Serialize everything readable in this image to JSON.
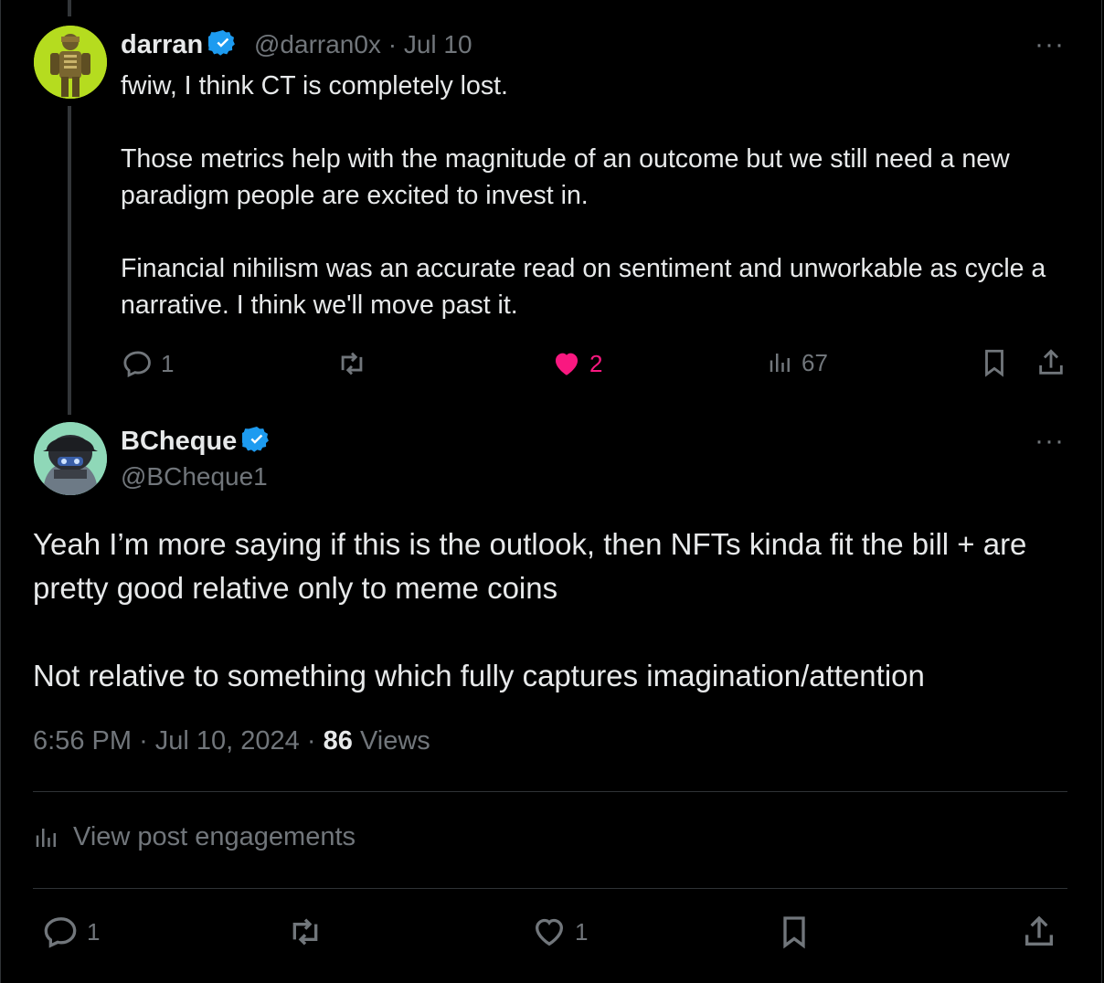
{
  "colors": {
    "background": "#000000",
    "text": "#e7e9ea",
    "muted": "#71767b",
    "like": "#f91880",
    "verified": "#1d9bf0"
  },
  "tweet1": {
    "name": "darran",
    "handle": "@darran0x",
    "date": "Jul 10",
    "body": "fwiw, I think CT is completely lost.\n\nThose metrics help with the magnitude of an outcome but we still need a new paradigm people are excited to invest in.\n\nFinancial nihilism was an accurate read on sentiment and unworkable as cycle a narrative. I think we'll move past it.",
    "replies": "1",
    "retweets": "",
    "likes": "2",
    "views": "67",
    "more": "···"
  },
  "tweet2": {
    "name": "BCheque",
    "handle": "@BCheque1",
    "body": "Yeah I’m more saying if this is the outlook, then NFTs kinda fit the bill + are pretty good relative only to meme coins\n\nNot relative to something which fully captures imagination/attention",
    "time": "6:56 PM",
    "date": "Jul 10, 2024",
    "views_count": "86",
    "views_label": "Views",
    "engagements_label": "View post engagements",
    "replies": "1",
    "retweets": "",
    "likes": "1",
    "more": "···"
  }
}
